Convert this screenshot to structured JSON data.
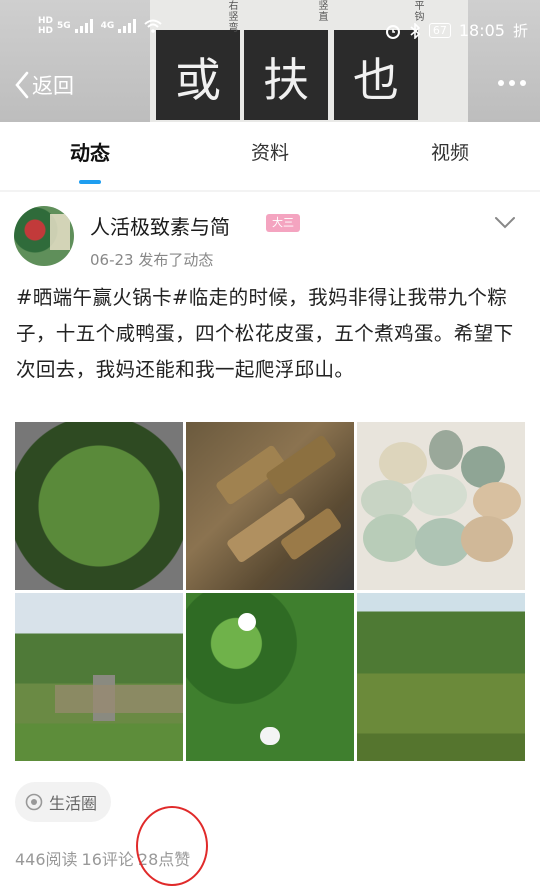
{
  "status_bar": {
    "network_left": "HD",
    "network_sub": "8",
    "signal_type_1": "5G",
    "signal_type_2": "4G",
    "battery": "67",
    "time": "18:05",
    "extra": "折"
  },
  "header": {
    "back_label": "返回",
    "banner_chars": [
      "或",
      "扶",
      "也"
    ],
    "banner_notes": [
      "右竖弯",
      "竖直",
      "平钩"
    ]
  },
  "tabs": [
    {
      "label": "动态",
      "active": true
    },
    {
      "label": "资料",
      "active": false
    },
    {
      "label": "视频",
      "active": false
    }
  ],
  "post": {
    "author": "人活极致素与简",
    "level": "大三",
    "date": "06-23",
    "action": "发布了动态",
    "text": "#晒端午赢火锅卡#临走的时候，我妈非得让我带九个粽子，十五个咸鸭蛋，四个松花皮蛋，五个煮鸡蛋。希望下次回去，我妈还能和我一起爬浮邱山。",
    "images": [
      "zongzi-basket",
      "zongzi-plate",
      "eggs-bowl",
      "mountain-stone",
      "leaves-flower",
      "bamboo-slope"
    ],
    "tag": "生活圈",
    "stats": {
      "reads": "446阅读",
      "comments": "16评论",
      "likes": "28点赞"
    }
  },
  "colors": {
    "accent": "#1e9ef0",
    "level_badge": "#f4a4c0",
    "annotation": "#e02a2a"
  }
}
